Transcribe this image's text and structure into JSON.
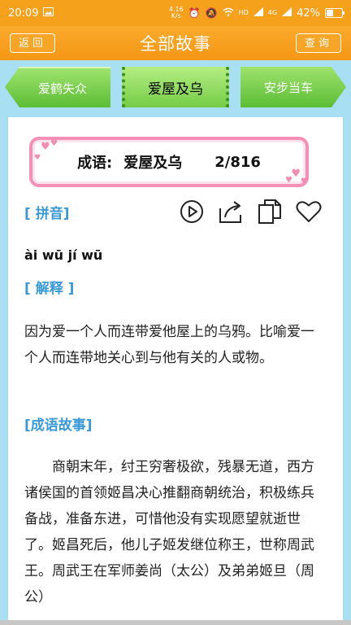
{
  "status_bar": {
    "time": "20:09",
    "net_speed_top": "4.16",
    "net_speed_bottom": "K/s",
    "network_hd": "HD",
    "network_4g": "4G",
    "battery": "42%"
  },
  "header": {
    "back_label": "返回",
    "title": "全部故事",
    "query_label": "查询"
  },
  "nav": {
    "prev": "爱鹤失众",
    "current": "爱屋及乌",
    "next": "安步当车"
  },
  "banner": {
    "label": "成语:",
    "idiom": "爱屋及乌",
    "counter": "2/816"
  },
  "sections": {
    "pinyin_heading": "[ 拼音]",
    "pinyin": "ài wū jí wū",
    "explain_heading": "[ 解释 ]",
    "explain_text": "因为爱一个人而连带爱他屋上的乌鸦。比喻爱一个人而连带地关心到与他有关的人或物。",
    "story_heading": "[成语故事]",
    "story_text": "商朝末年，纣王穷奢极欲，残暴无道，西方诸侯国的首领姬昌决心推翻商朝统治，积极练兵备战，准备东进，可惜他没有实现愿望就逝世了。姬昌死后，他儿子姬发继位称王，世称周武王。周武王在军师姜尚（太公）及弟弟姬旦（周公）"
  },
  "icons": {
    "play": "play-icon",
    "share": "share-icon",
    "copy": "copy-icon",
    "favorite": "heart-icon"
  },
  "colors": {
    "header_orange": "#f6a11c",
    "nav_green": "#5cbd35",
    "heading_blue": "#3a9ad9",
    "banner_pink": "#f48fb7",
    "background": "#a8dff2"
  }
}
